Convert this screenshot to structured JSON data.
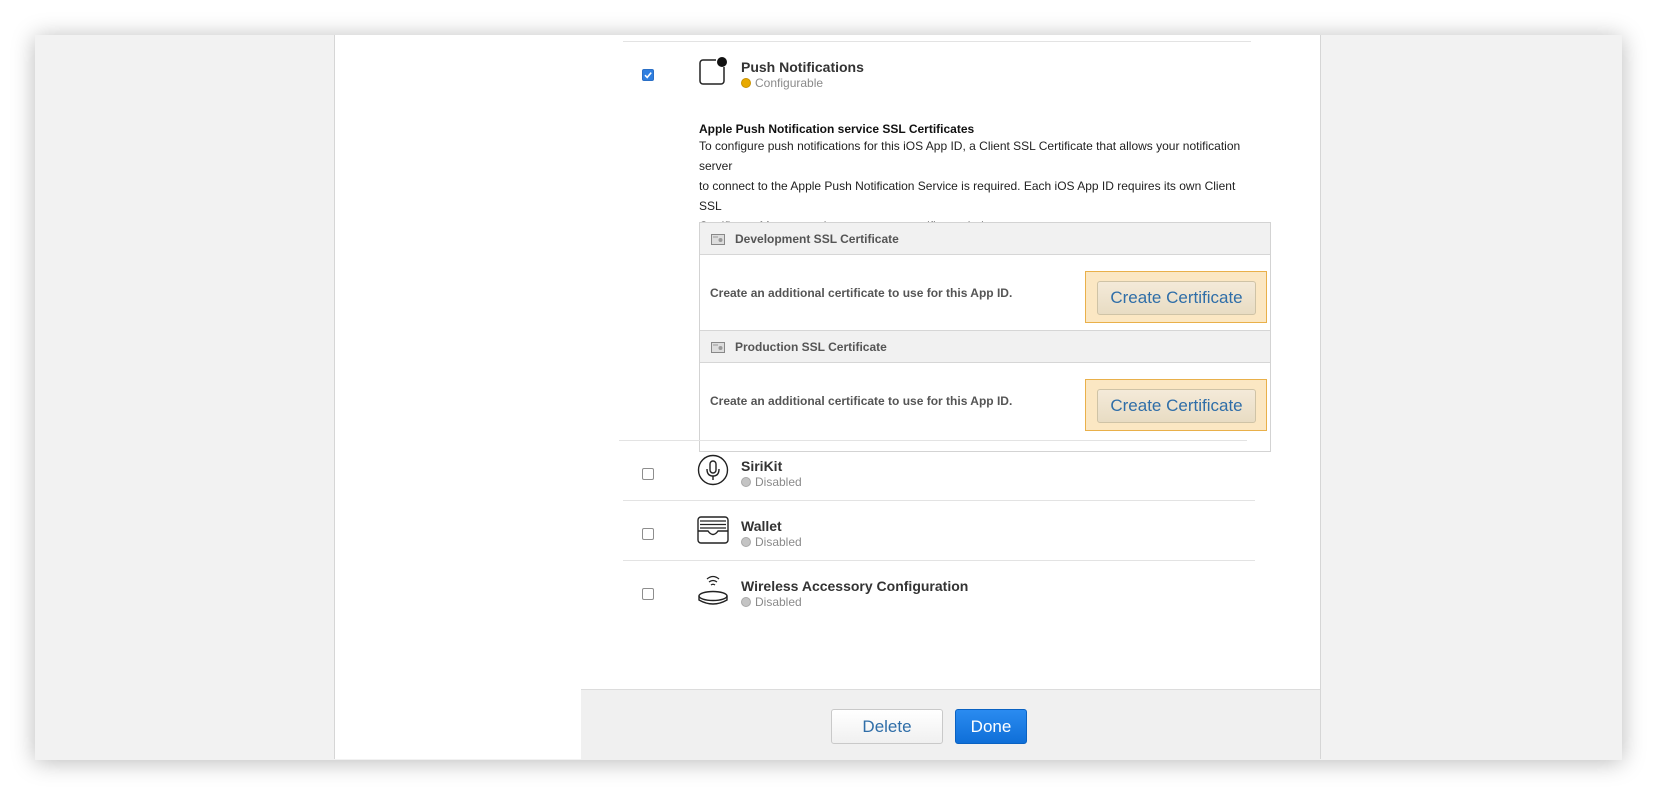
{
  "push": {
    "name": "Push Notifications",
    "status": "Configurable",
    "checked": true,
    "icon": "push-notification-icon",
    "ssl_title": "Apple Push Notification service SSL Certificates",
    "ssl_desc_lines": [
      "To configure push notifications for this iOS App ID, a Client SSL Certificate that allows your notification server",
      "to connect to the Apple Push Notification Service is required. Each iOS App ID requires its own Client SSL",
      "Certificate. Manage and generate your certificates below."
    ],
    "development": {
      "title": "Development SSL Certificate",
      "text": "Create an additional certificate to use for this App ID.",
      "button": "Create Certificate"
    },
    "production": {
      "title": "Production SSL Certificate",
      "text": "Create an additional certificate to use for this App ID.",
      "button": "Create Certificate"
    }
  },
  "capabilities": [
    {
      "name": "SiriKit",
      "status": "Disabled",
      "checked": false,
      "icon": "microphone-icon"
    },
    {
      "name": "Wallet",
      "status": "Disabled",
      "checked": false,
      "icon": "wallet-icon"
    },
    {
      "name": "Wireless Accessory Configuration",
      "status": "Disabled",
      "checked": false,
      "icon": "wireless-accessory-icon"
    }
  ],
  "footer": {
    "delete_label": "Delete",
    "done_label": "Done"
  },
  "colors": {
    "configurable_dot": "#e8a900",
    "disabled_dot": "#c4c4c4",
    "done_button": "#1479e2",
    "button_text": "#2f6ea8",
    "highlight_border": "#e9b04a"
  }
}
